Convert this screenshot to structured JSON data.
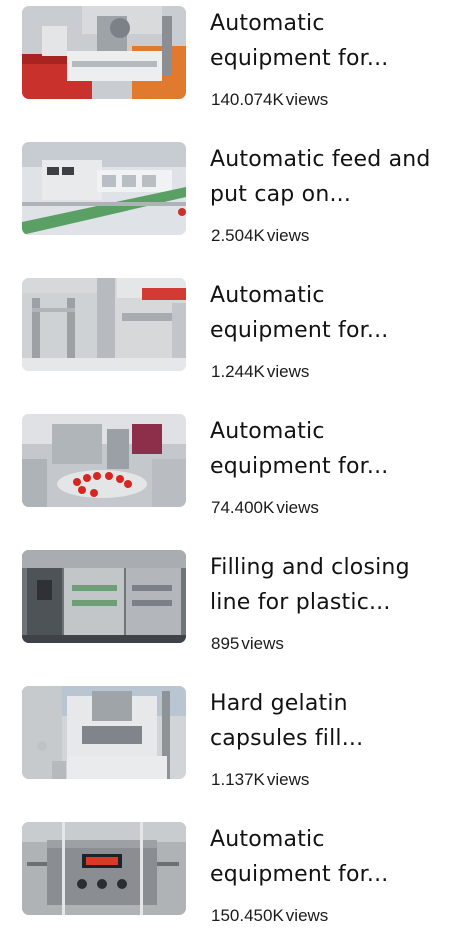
{
  "videos": [
    {
      "title": "Automatic equipment for...",
      "views": "140.074K",
      "views_suffix": "views",
      "thumbnail": "capping-machine-red-floor"
    },
    {
      "title": "Automatic feed and put cap on...",
      "views": "2.504K",
      "views_suffix": "views",
      "thumbnail": "conveyor-cap-feeder"
    },
    {
      "title": "Automatic equipment for...",
      "views": "1.244K",
      "views_suffix": "views",
      "thumbnail": "stainless-filler-nozzle"
    },
    {
      "title": "Automatic equipment for...",
      "views": "74.400K",
      "views_suffix": "views",
      "thumbnail": "rotary-table-red-caps"
    },
    {
      "title": "Filling and closing line for plastic...",
      "views": "895",
      "views_suffix": "views",
      "thumbnail": "enclosed-filling-line"
    },
    {
      "title": "Hard gelatin capsules fill...",
      "views": "1.137K",
      "views_suffix": "views",
      "thumbnail": "capsule-filling-machine"
    },
    {
      "title": "Automatic equipment for...",
      "views": "150.450K",
      "views_suffix": "views",
      "thumbnail": "digital-pump-filler"
    }
  ]
}
